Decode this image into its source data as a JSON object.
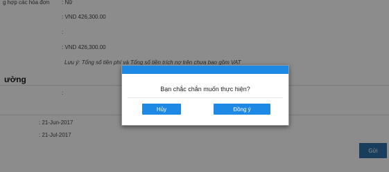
{
  "form": {
    "top_partial_label": "g hợp các hóa đơn",
    "top_partial_value": ": Nữ",
    "amount_1": ": VND 426,300.00",
    "colon_1": ":",
    "amount_2": ": VND 426,300.00",
    "note": "Lưu ý: Tổng số tiền phí và Tổng số tiền trích nợ trên chưa bao gồm VAT",
    "section_title": "ường",
    "colon_2": ":",
    "date_1": ": 21-Jun-2017",
    "date_2": ": 21-Jul-2017",
    "send_label": "Gửi"
  },
  "dialog": {
    "message": "Bạn chắc chắn muốn thực hiện?",
    "cancel_label": "Hủy",
    "ok_label": "Đồng ý"
  },
  "colors": {
    "dialog_header": "#1e88e5",
    "button_primary": "#1e88e5",
    "send_button": "#2f6fa8",
    "overlay": "rgba(0,0,0,0.45)"
  }
}
